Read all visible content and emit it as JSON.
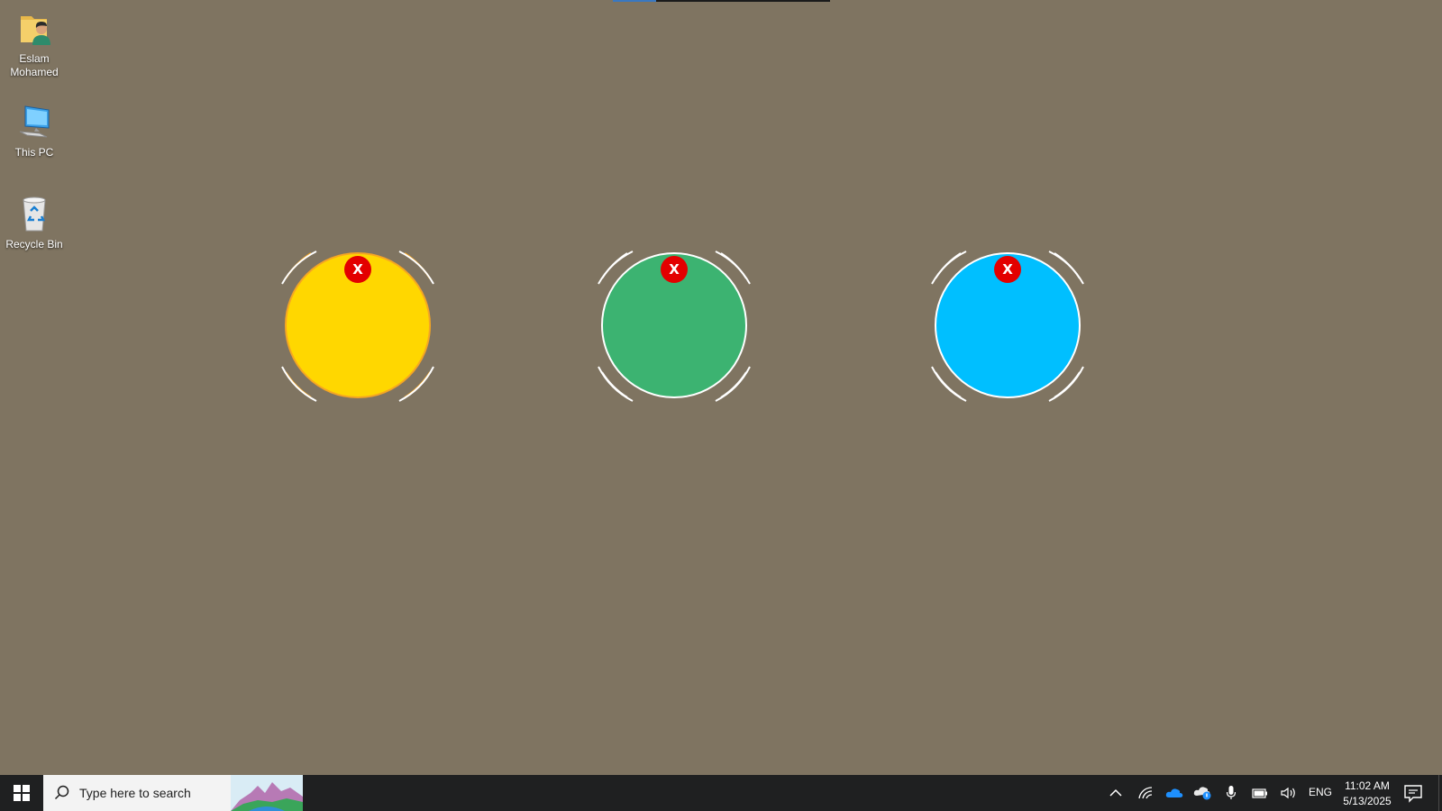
{
  "desktop": {
    "icons": [
      {
        "label": "Eslam Mohamed",
        "icon": "user-folder-icon"
      },
      {
        "label": "This PC",
        "icon": "computer-icon"
      },
      {
        "label": "Recycle Bin",
        "icon": "recycle-bin-icon"
      }
    ],
    "background_color": "#7f7461"
  },
  "widgets": [
    {
      "color": "#ffd700",
      "ring_color": "#f5a623",
      "close_label": "X"
    },
    {
      "color": "#3cb371",
      "ring_color": "#ffffff",
      "close_label": "X"
    },
    {
      "color": "#00bfff",
      "ring_color": "#ffffff",
      "close_label": "X"
    }
  ],
  "taskbar": {
    "search_placeholder": "Type here to search",
    "tray_icons": [
      "chevron-up-icon",
      "wifi-icon",
      "onedrive-icon",
      "cloud-sync-icon",
      "microphone-icon",
      "battery-icon",
      "volume-icon"
    ],
    "language": "ENG",
    "time": "11:02 AM",
    "date": "5/13/2025"
  }
}
